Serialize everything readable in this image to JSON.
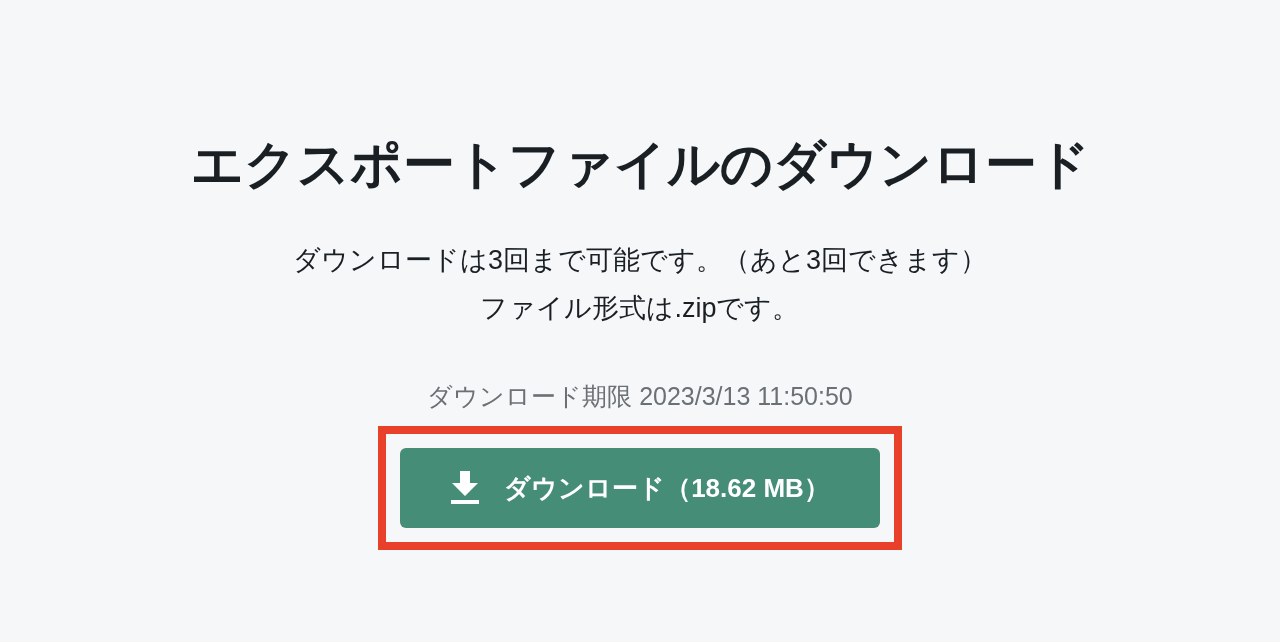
{
  "title": "エクスポートファイルのダウンロード",
  "description": [
    "ダウンロードは3回まで可能です。（あと3回できます）",
    "ファイル形式は.zipです。"
  ],
  "deadline": "ダウンロード期限 2023/3/13 11:50:50",
  "download_button": {
    "label": "ダウンロード（18.62 MB）",
    "highlighted": true
  }
}
